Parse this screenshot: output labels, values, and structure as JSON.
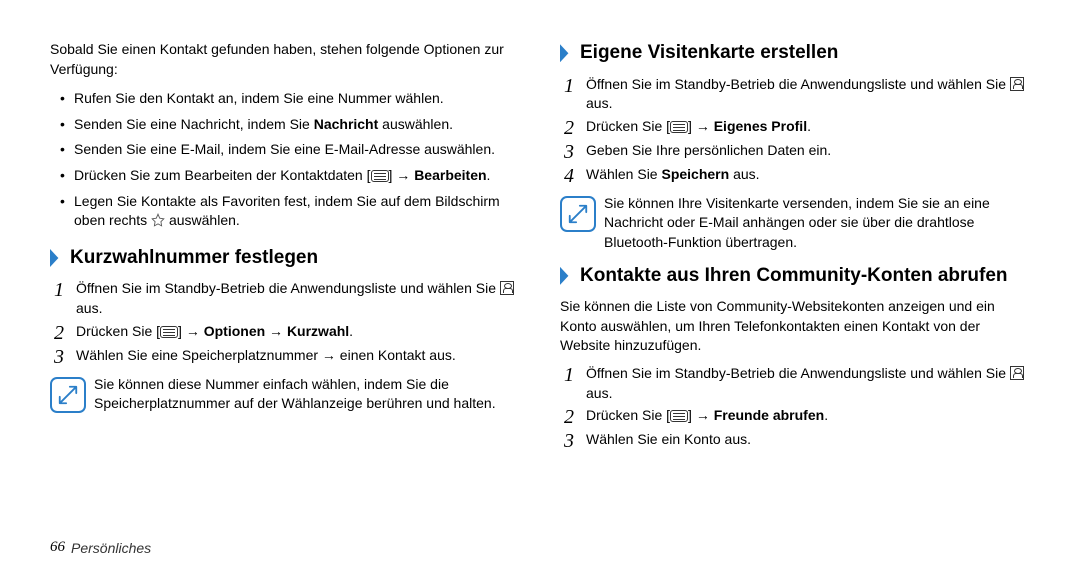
{
  "left": {
    "intro": "Sobald Sie einen Kontakt gefunden haben, stehen folgende Optionen zur Verfügung:",
    "bullets": {
      "b0": "Rufen Sie den Kontakt an, indem Sie eine Nummer wählen.",
      "b1_pre": "Senden Sie eine Nachricht, indem Sie ",
      "b1_bold": "Nachricht",
      "b1_post": " auswählen.",
      "b2": "Senden Sie eine E-Mail, indem Sie eine E-Mail-Adresse auswählen.",
      "b3_pre": "Drücken Sie zum Bearbeiten der Kontaktdaten [",
      "b3_arrow": "] → ",
      "b3_bold": "Bearbeiten",
      "b3_post": ".",
      "b4_pre": "Legen Sie Kontakte als Favoriten fest, indem Sie auf dem Bildschirm oben rechts ",
      "b4_post": " auswählen."
    },
    "sec1_title": "Kurzwahlnummer festlegen",
    "sec1_steps": {
      "s1_pre": "Öffnen Sie im Standby-Betrieb die Anwendungsliste und wählen Sie ",
      "s1_post": " aus.",
      "s2_pre": "Drücken Sie [",
      "s2_arrow": "] → ",
      "s2_b1": "Optionen",
      "s2_mid": " → ",
      "s2_b2": "Kurzwahl",
      "s2_post": ".",
      "s3": "Wählen Sie eine Speicherplatznummer → einen Kontakt aus."
    },
    "sec1_note": "Sie können diese Nummer einfach wählen, indem Sie die Speicherplatznummer auf der Wählanzeige berühren und halten."
  },
  "right": {
    "sec1_title": "Eigene Visitenkarte erstellen",
    "sec1_steps": {
      "s1_pre": "Öffnen Sie im Standby-Betrieb die Anwendungsliste und wählen Sie ",
      "s1_post": " aus.",
      "s2_pre": "Drücken Sie [",
      "s2_arrow": "] → ",
      "s2_bold": "Eigenes Profil",
      "s2_post": ".",
      "s3": "Geben Sie Ihre persönlichen Daten ein.",
      "s4_pre": "Wählen Sie ",
      "s4_bold": "Speichern",
      "s4_post": " aus."
    },
    "sec1_note": "Sie können Ihre Visitenkarte versenden, indem Sie sie an eine Nachricht oder E-Mail anhängen oder sie über die drahtlose Bluetooth-Funktion übertragen.",
    "sec2_title": "Kontakte aus Ihren Community-Konten abrufen",
    "sec2_intro": "Sie können die Liste von Community-Websitekonten anzeigen und ein Konto auswählen, um Ihren Telefonkontakten einen Kontakt von der Website hinzuzufügen.",
    "sec2_steps": {
      "s1_pre": "Öffnen Sie im Standby-Betrieb die Anwendungsliste und wählen Sie ",
      "s1_post": " aus.",
      "s2_pre": "Drücken Sie [",
      "s2_arrow": "] → ",
      "s2_bold": "Freunde abrufen",
      "s2_post": ".",
      "s3": "Wählen Sie ein Konto aus."
    }
  },
  "footer": {
    "pagenum": "66",
    "label": "Persönliches"
  }
}
